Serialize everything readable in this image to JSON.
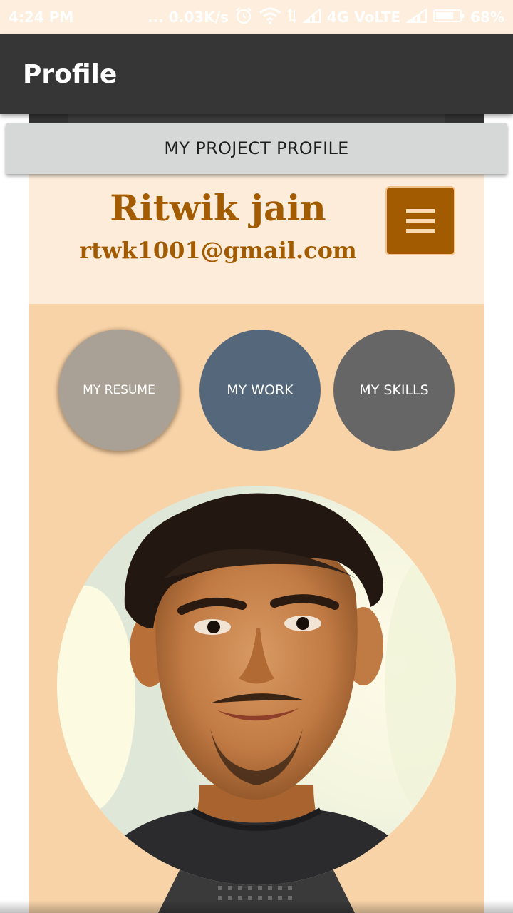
{
  "status_bar": {
    "time": "4:24 PM",
    "network_speed": "... 0.03K/s",
    "network_type": "4G",
    "volte": "VoLTE",
    "battery": "68%",
    "icons": [
      "alarm-icon",
      "wifi-icon",
      "signal-icon",
      "battery-icon"
    ]
  },
  "app_bar": {
    "title": "Profile"
  },
  "project_bar": {
    "label": "MY PROJECT PROFILE"
  },
  "profile": {
    "name": "Ritwik jain",
    "email": "rtwk1001@gmail.com"
  },
  "menu_button": {
    "icon": "hamburger-menu-icon"
  },
  "nav_circles": [
    {
      "label": "MY RESUME",
      "color": "#aaa196"
    },
    {
      "label": "MY WORK",
      "color": "#55687b"
    },
    {
      "label": "MY SKILLS",
      "color": "#666666"
    }
  ],
  "photo": {
    "kind": "profile-photo"
  },
  "colors": {
    "accent": "#a35b00",
    "header_bg": "#fdecd9",
    "content_bg": "#f8d3a8",
    "app_bar": "#363636"
  }
}
